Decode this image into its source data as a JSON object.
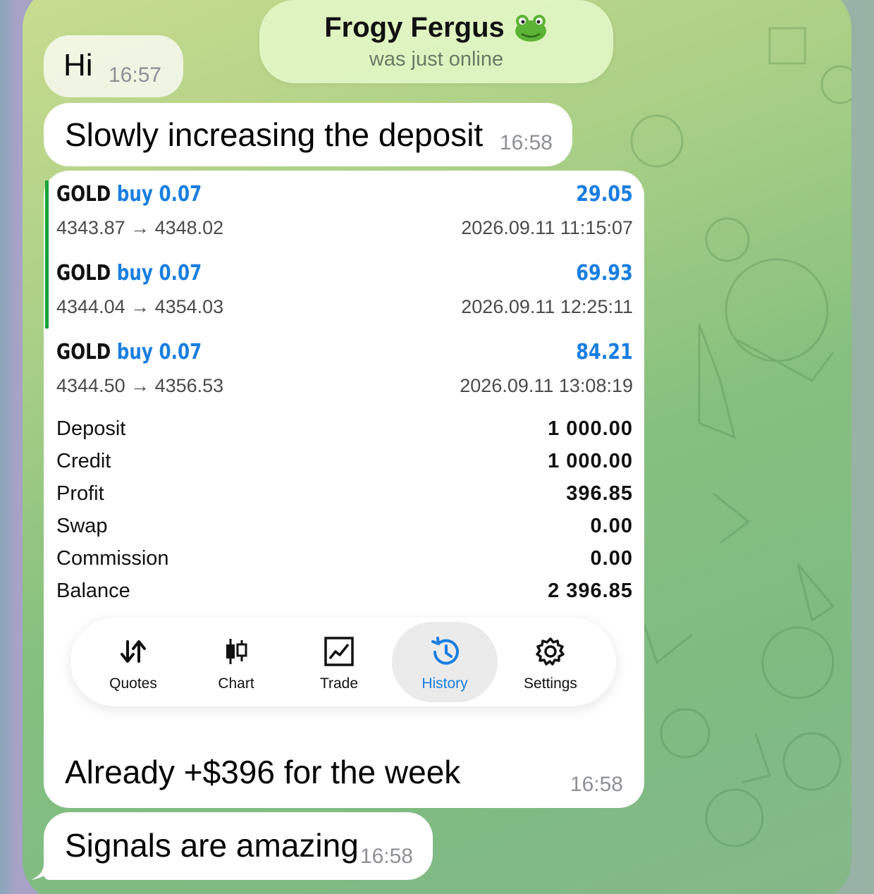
{
  "header": {
    "name": "Frogy Fergus",
    "emoji": "🐸",
    "status": "was just online"
  },
  "messages": {
    "hi": {
      "text": "Hi",
      "time": "16:57"
    },
    "slowly": {
      "text": "Slowly increasing the deposit",
      "time": "16:58"
    },
    "card": {
      "caption": "Already +$396 for the week",
      "time": "16:58"
    },
    "signals": {
      "text": "Signals are amazing",
      "time": "16:58"
    }
  },
  "trades": [
    {
      "symbol": "GOLD",
      "direction": "buy 0.07",
      "profit": "29.05",
      "prices": "4343.87 → 4348.02",
      "date": "2026.09.11 11:15:07"
    },
    {
      "symbol": "GOLD",
      "direction": "buy 0.07",
      "profit": "69.93",
      "prices": "4344.04 → 4354.03",
      "date": "2026.09.11 12:25:11"
    },
    {
      "symbol": "GOLD",
      "direction": "buy 0.07",
      "profit": "84.21",
      "prices": "4344.50 → 4356.53",
      "date": "2026.09.11 13:08:19"
    }
  ],
  "summary": [
    {
      "label": "Deposit",
      "value": "1 000.00"
    },
    {
      "label": "Credit",
      "value": "1 000.00"
    },
    {
      "label": "Profit",
      "value": "396.85"
    },
    {
      "label": "Swap",
      "value": "0.00"
    },
    {
      "label": "Commission",
      "value": "0.00"
    },
    {
      "label": "Balance",
      "value": "2 396.85"
    }
  ],
  "nav": [
    {
      "label": "Quotes",
      "icon": "quotes-arrows-icon"
    },
    {
      "label": "Chart",
      "icon": "candlestick-icon"
    },
    {
      "label": "Trade",
      "icon": "trade-chart-icon"
    },
    {
      "label": "History",
      "icon": "history-clock-icon",
      "active": true
    },
    {
      "label": "Settings",
      "icon": "gear-icon"
    }
  ],
  "colors": {
    "accent": "#1a7ee0",
    "trade_bar": "#17a33a",
    "chat_bg": "#86c07f"
  }
}
